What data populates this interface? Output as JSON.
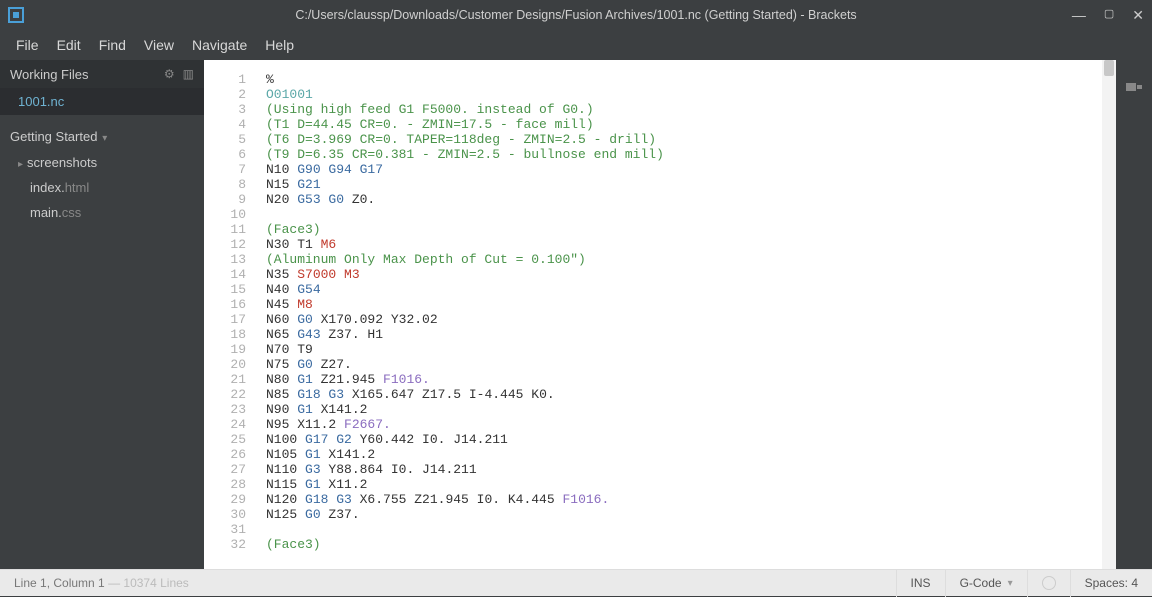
{
  "title": "C:/Users/claussp/Downloads/Customer Designs/Fusion Archives/1001.nc (Getting Started) - Brackets",
  "menu": {
    "file": "File",
    "edit": "Edit",
    "find": "Find",
    "view": "View",
    "navigate": "Navigate",
    "help": "Help"
  },
  "sidebar": {
    "working_files_label": "Working Files",
    "active_file": "1001.nc",
    "project_label": "Getting Started",
    "tree": {
      "folder1": "screenshots",
      "file1_base": "index.",
      "file1_ext": "html",
      "file2_base": "main.",
      "file2_ext": "css"
    }
  },
  "status": {
    "cursor": "Line 1, Column 1",
    "lines": " — 10374 Lines",
    "ins": "INS",
    "lang": "G-Code",
    "spaces": "Spaces: 4"
  },
  "code": [
    [
      [
        "default",
        "%"
      ]
    ],
    [
      [
        "oprog",
        "O01001"
      ]
    ],
    [
      [
        "comment",
        "(Using high feed G1 F5000. instead of G0.)"
      ]
    ],
    [
      [
        "comment",
        "(T1 D=44.45 CR=0. - ZMIN=17.5 - face mill)"
      ]
    ],
    [
      [
        "comment",
        "(T6 D=3.969 CR=0. TAPER=118deg - ZMIN=2.5 - drill)"
      ]
    ],
    [
      [
        "comment",
        "(T9 D=6.35 CR=0.381 - ZMIN=2.5 - bullnose end mill)"
      ]
    ],
    [
      [
        "default",
        "N10 "
      ],
      [
        "gmode",
        "G90 G94 G17"
      ]
    ],
    [
      [
        "default",
        "N15 "
      ],
      [
        "gmode",
        "G21"
      ]
    ],
    [
      [
        "default",
        "N20 "
      ],
      [
        "gmode",
        "G53 G0"
      ],
      [
        "default",
        " Z0."
      ]
    ],
    [
      [
        "default",
        ""
      ]
    ],
    [
      [
        "comment",
        "(Face3)"
      ]
    ],
    [
      [
        "default",
        "N30 T1 "
      ],
      [
        "mcode",
        "M6"
      ]
    ],
    [
      [
        "comment",
        "(Aluminum Only Max Depth of Cut = 0.100\")"
      ]
    ],
    [
      [
        "default",
        "N35 "
      ],
      [
        "scode",
        "S7000"
      ],
      [
        "default",
        " "
      ],
      [
        "mcode",
        "M3"
      ]
    ],
    [
      [
        "default",
        "N40 "
      ],
      [
        "gmode",
        "G54"
      ]
    ],
    [
      [
        "default",
        "N45 "
      ],
      [
        "mcode",
        "M8"
      ]
    ],
    [
      [
        "default",
        "N60 "
      ],
      [
        "gmode",
        "G0"
      ],
      [
        "default",
        " X170.092 Y32.02"
      ]
    ],
    [
      [
        "default",
        "N65 "
      ],
      [
        "gmode",
        "G43"
      ],
      [
        "default",
        " Z37. H1"
      ]
    ],
    [
      [
        "default",
        "N70 T9"
      ]
    ],
    [
      [
        "default",
        "N75 "
      ],
      [
        "gmode",
        "G0"
      ],
      [
        "default",
        " Z27."
      ]
    ],
    [
      [
        "default",
        "N80 "
      ],
      [
        "gmode",
        "G1"
      ],
      [
        "default",
        " Z21.945 "
      ],
      [
        "feed",
        "F1016."
      ]
    ],
    [
      [
        "default",
        "N85 "
      ],
      [
        "gmode",
        "G18 G3"
      ],
      [
        "default",
        " X165.647 Z17.5 I-4.445 K0."
      ]
    ],
    [
      [
        "default",
        "N90 "
      ],
      [
        "gmode",
        "G1"
      ],
      [
        "default",
        " X141.2"
      ]
    ],
    [
      [
        "default",
        "N95 X11.2 "
      ],
      [
        "feed",
        "F2667."
      ]
    ],
    [
      [
        "default",
        "N100 "
      ],
      [
        "gmode",
        "G17 G2"
      ],
      [
        "default",
        " Y60.442 I0. J14.211"
      ]
    ],
    [
      [
        "default",
        "N105 "
      ],
      [
        "gmode",
        "G1"
      ],
      [
        "default",
        " X141.2"
      ]
    ],
    [
      [
        "default",
        "N110 "
      ],
      [
        "gmode",
        "G3"
      ],
      [
        "default",
        " Y88.864 I0. J14.211"
      ]
    ],
    [
      [
        "default",
        "N115 "
      ],
      [
        "gmode",
        "G1"
      ],
      [
        "default",
        " X11.2"
      ]
    ],
    [
      [
        "default",
        "N120 "
      ],
      [
        "gmode",
        "G18 G3"
      ],
      [
        "default",
        " X6.755 Z21.945 I0. K4.445 "
      ],
      [
        "feed",
        "F1016."
      ]
    ],
    [
      [
        "default",
        "N125 "
      ],
      [
        "gmode",
        "G0"
      ],
      [
        "default",
        " Z37."
      ]
    ],
    [
      [
        "default",
        ""
      ]
    ],
    [
      [
        "comment",
        "(Face3)"
      ]
    ]
  ]
}
